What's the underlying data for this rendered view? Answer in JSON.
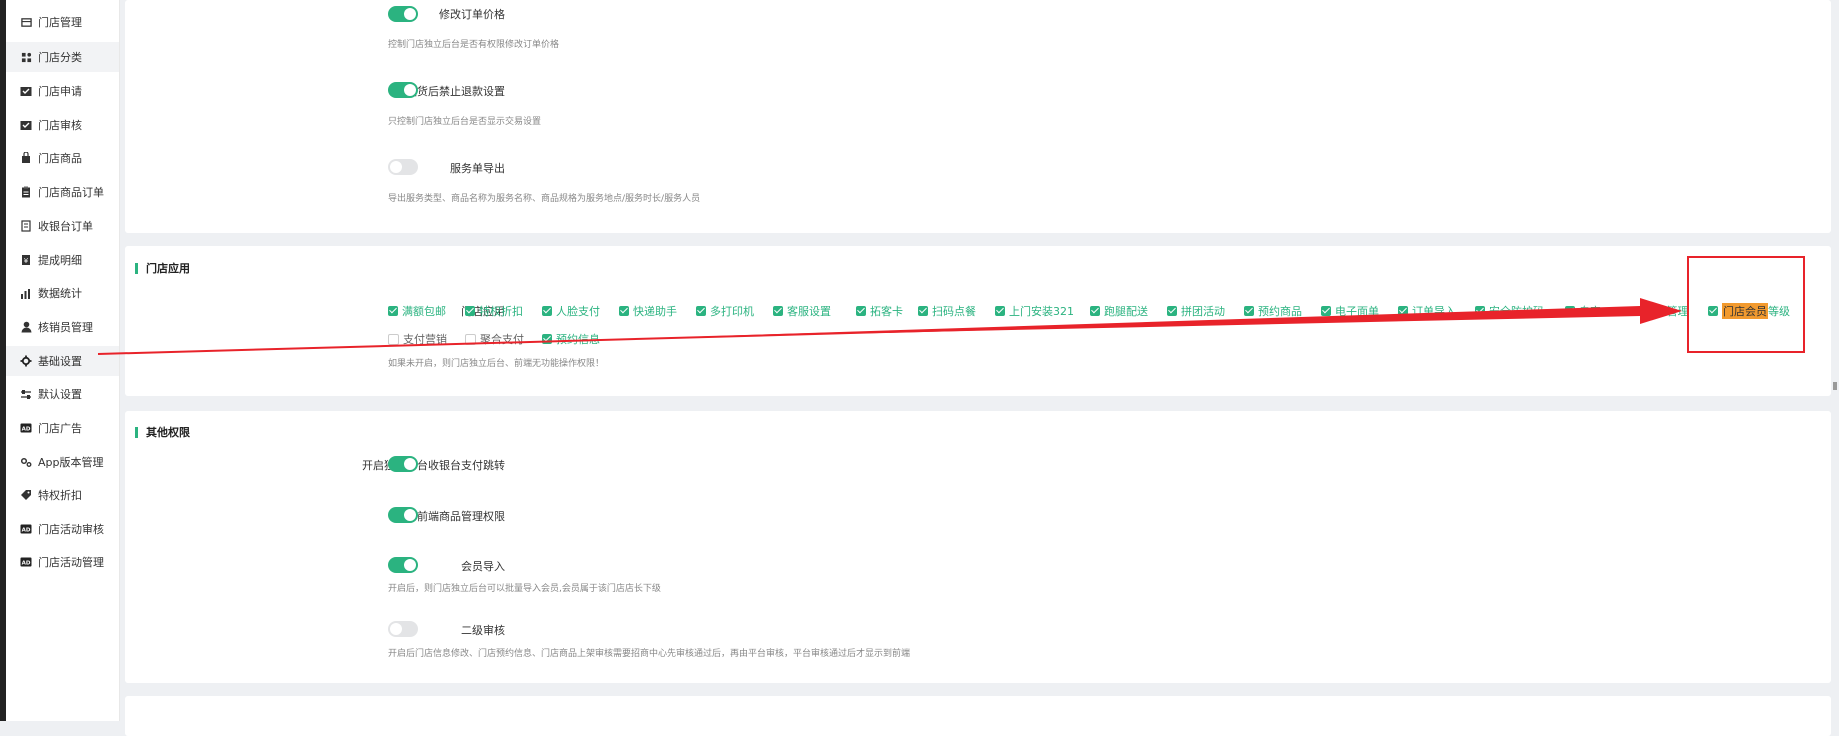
{
  "sidebar": {
    "items": [
      {
        "label": "门店管理",
        "icon": "store-icon"
      },
      {
        "label": "门店分类",
        "icon": "category-icon"
      },
      {
        "label": "门店申请",
        "icon": "inbox-check-icon"
      },
      {
        "label": "门店审核",
        "icon": "inbox-check-icon"
      },
      {
        "label": "门店商品",
        "icon": "bag-icon"
      },
      {
        "label": "门店商品订单",
        "icon": "clipboard-icon"
      },
      {
        "label": "收银台订单",
        "icon": "receipt-icon"
      },
      {
        "label": "提成明细",
        "icon": "ledger-icon"
      },
      {
        "label": "数据统计",
        "icon": "bar-chart-icon"
      },
      {
        "label": "核销员管理",
        "icon": "user-icon"
      },
      {
        "label": "基础设置",
        "icon": "gear-icon"
      },
      {
        "label": "默认设置",
        "icon": "sliders-icon"
      },
      {
        "label": "门店广告",
        "icon": "ad-icon"
      },
      {
        "label": "App版本管理",
        "icon": "gears-icon"
      },
      {
        "label": "特权折扣",
        "icon": "tag-icon"
      },
      {
        "label": "门店活动审核",
        "icon": "ad-icon"
      },
      {
        "label": "门店活动管理",
        "icon": "ad-icon"
      }
    ]
  },
  "top_settings": {
    "order_price": {
      "label": "修改订单价格",
      "hint": "控制门店独立后台是否有权限修改订单价格",
      "on": true
    },
    "no_refund": {
      "label": "发货后禁止退款设置",
      "hint": "只控制门店独立后台是否显示交易设置",
      "on": true
    },
    "service_export": {
      "label": "服务单导出",
      "hint": "导出服务类型、商品名称为服务名称、商品规格为服务地点/服务时长/服务人员",
      "on": false
    }
  },
  "store_apps": {
    "section_title": "门店应用",
    "row_label": "门店应用",
    "options_row1": [
      "满额包邮",
      "特权折扣",
      "人脸支付",
      "快递助手",
      "多打印机",
      "客服设置",
      "拓客卡",
      "扫码点餐",
      "上门安装321",
      "跑腿配送",
      "拼团活动",
      "预约商品",
      "电子面单",
      "订单导入",
      "安全防护码",
      "自定...",
      "...管理"
    ],
    "highlighted_option": {
      "highlight": "门店会员",
      "rest": "等级"
    },
    "options_row2": [
      {
        "label": "支付营销",
        "checked": false
      },
      {
        "label": "聚合支付",
        "checked": false
      },
      {
        "label": "预约信息",
        "checked": true
      }
    ],
    "hint": "如果未开启，则门店独立后台、前端无功能操作权限！"
  },
  "other_perms": {
    "section_title": "其他权限",
    "cashier_jump": {
      "label": "开启独立平台收银台支付跳转",
      "on": true
    },
    "frontend_goods": {
      "label": "前端商品管理权限",
      "on": true
    },
    "member_import": {
      "label": "会员导入",
      "hint": "开启后，则门店独立后台可以批量导入会员,会员属于该门店店长下级",
      "on": true
    },
    "second_review": {
      "label": "二级审核",
      "hint": "开启后门店信息修改、门店预约信息、门店商品上架审核需要招商中心先审核通过后，再由平台审核，平台审核通过后才显示到前端",
      "on": false
    }
  },
  "colors": {
    "accent": "#2bb380",
    "annotation": "#e8232a",
    "highlight": "#f29a2e"
  }
}
